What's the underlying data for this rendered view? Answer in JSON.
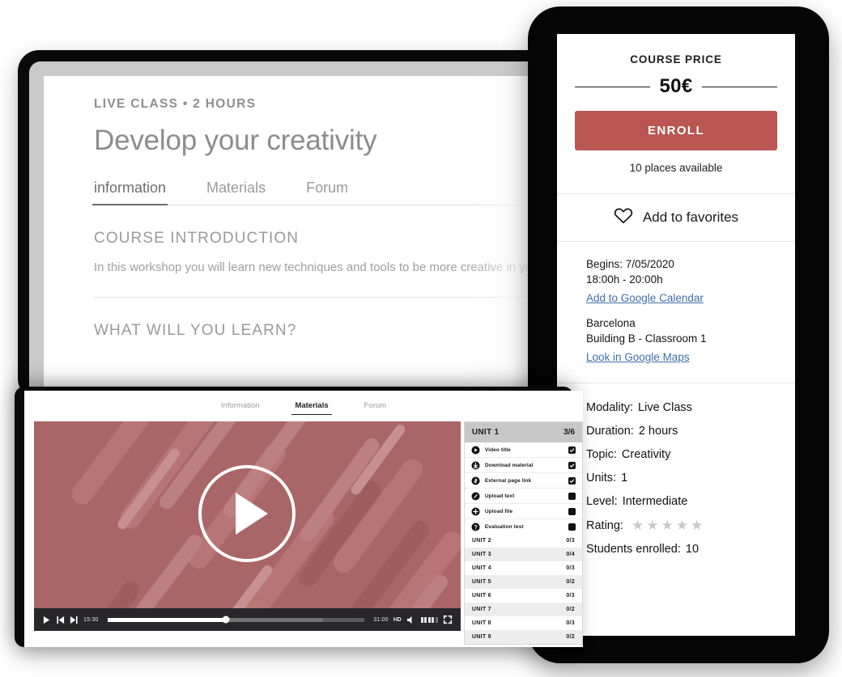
{
  "tablet": {
    "kicker": "LIVE CLASS • 2 HOURS",
    "title": "Develop your creativity",
    "tabs": [
      {
        "label": "information",
        "active": true
      },
      {
        "label": "Materials",
        "active": false
      },
      {
        "label": "Forum",
        "active": false
      }
    ],
    "sections": [
      {
        "heading": "COURSE INTRODUCTION",
        "body": "In this workshop you will learn new techniques and tools to be more creative in yo"
      },
      {
        "heading": "WHAT WILL YOU LEARN?",
        "body": ""
      }
    ]
  },
  "sidecard": {
    "price_label": "COURSE PRICE",
    "price_value": "50€",
    "enroll_label": "ENROLL",
    "places": "10 places available",
    "favorites_label": "Add to favorites",
    "favorites_icon": "heart-icon",
    "schedule": {
      "begins_label": "Begins:",
      "begins_value": "7/05/2020",
      "time": "18:00h  -  20:00h",
      "calendar_link": "Add to Google Calendar",
      "city": "Barcelona",
      "room": "Building B - Classroom 1",
      "maps_link": "Look in Google Maps"
    },
    "specs": [
      {
        "key": "Modality:",
        "value": "Live Class"
      },
      {
        "key": "Duration:",
        "value": "2 hours"
      },
      {
        "key": "Topic:",
        "value": "Creativity"
      },
      {
        "key": "Units:",
        "value": "1"
      },
      {
        "key": "Level:",
        "value": "Intermediate"
      },
      {
        "key": "Rating:",
        "value": "",
        "stars": 5,
        "stars_filled": 0
      },
      {
        "key": "Students enrolled:",
        "value": "10"
      }
    ],
    "accent_color": "#b95651",
    "link_color": "#3f6fa8"
  },
  "laptop": {
    "tabs": [
      {
        "label": "Information",
        "active": false
      },
      {
        "label": "Materials",
        "active": true
      },
      {
        "label": "Forum",
        "active": false
      }
    ],
    "player": {
      "play_icon": "play-icon",
      "prev_icon": "skip-previous-icon",
      "next_icon": "skip-next-icon",
      "current_time": "15:30",
      "total_time": "31:00",
      "quality": "HD",
      "volume_icon": "volume-icon",
      "fullscreen_icon": "fullscreen-icon",
      "progress_percent": 46,
      "background_color": "#a96666"
    },
    "unit_panel": {
      "header_title": "UNIT 1",
      "header_count": "3/6",
      "lessons": [
        {
          "icon": "play-circle-icon",
          "label": "Video title",
          "checked": true
        },
        {
          "icon": "download-circle-icon",
          "label": "Download material",
          "checked": true
        },
        {
          "icon": "link-circle-icon",
          "label": "External page link",
          "checked": true
        },
        {
          "icon": "pencil-circle-icon",
          "label": "Upload text",
          "checked": false
        },
        {
          "icon": "plus-circle-icon",
          "label": "Upload file",
          "checked": false
        },
        {
          "icon": "question-circle-icon",
          "label": "Evaluation test",
          "checked": false
        }
      ],
      "units": [
        {
          "label": "UNIT 2",
          "count": "0/3"
        },
        {
          "label": "UNIT 3",
          "count": "0/4"
        },
        {
          "label": "UNIT 4",
          "count": "0/3"
        },
        {
          "label": "UNIT 5",
          "count": "0/2"
        },
        {
          "label": "UNIT 6",
          "count": "0/3"
        },
        {
          "label": "UNIT 7",
          "count": "0/2"
        },
        {
          "label": "UNIT 8",
          "count": "0/3"
        },
        {
          "label": "UNIT 9",
          "count": "0/2"
        }
      ]
    }
  }
}
